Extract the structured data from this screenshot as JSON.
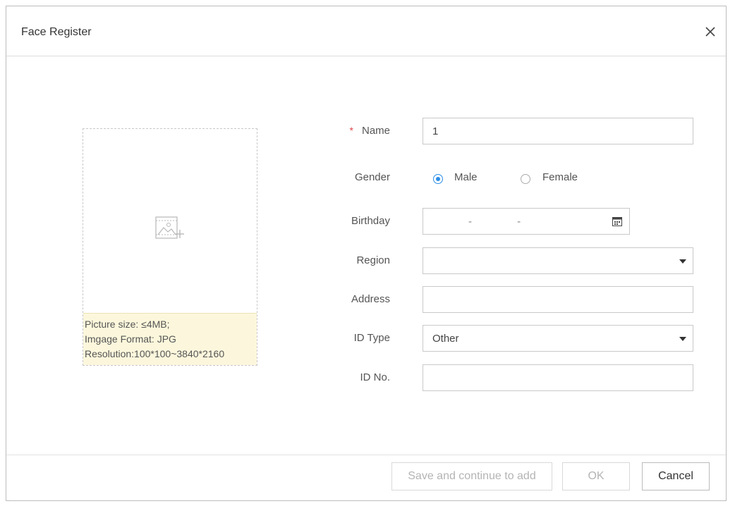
{
  "dialog": {
    "title": "Face Register"
  },
  "upload": {
    "hint_lines": [
      "Picture size: ≤4MB;",
      "Imgage Format: JPG",
      "Resolution:100*100~3840*2160"
    ]
  },
  "form": {
    "name": {
      "label": "Name",
      "value": "1"
    },
    "gender": {
      "label": "Gender",
      "options": [
        "Male",
        "Female"
      ],
      "selected": "Male"
    },
    "birthday": {
      "label": "Birthday",
      "value": "- -"
    },
    "region": {
      "label": "Region",
      "value": ""
    },
    "address": {
      "label": "Address",
      "value": ""
    },
    "id_type": {
      "label": "ID Type",
      "value": "Other"
    },
    "id_no": {
      "label": "ID No.",
      "value": ""
    }
  },
  "footer": {
    "save_continue": "Save and continue to add",
    "ok": "OK",
    "cancel": "Cancel"
  },
  "colors": {
    "accent": "#2a8ee8",
    "required": "#e0474e",
    "hint_bg": "#fcf7dc"
  }
}
